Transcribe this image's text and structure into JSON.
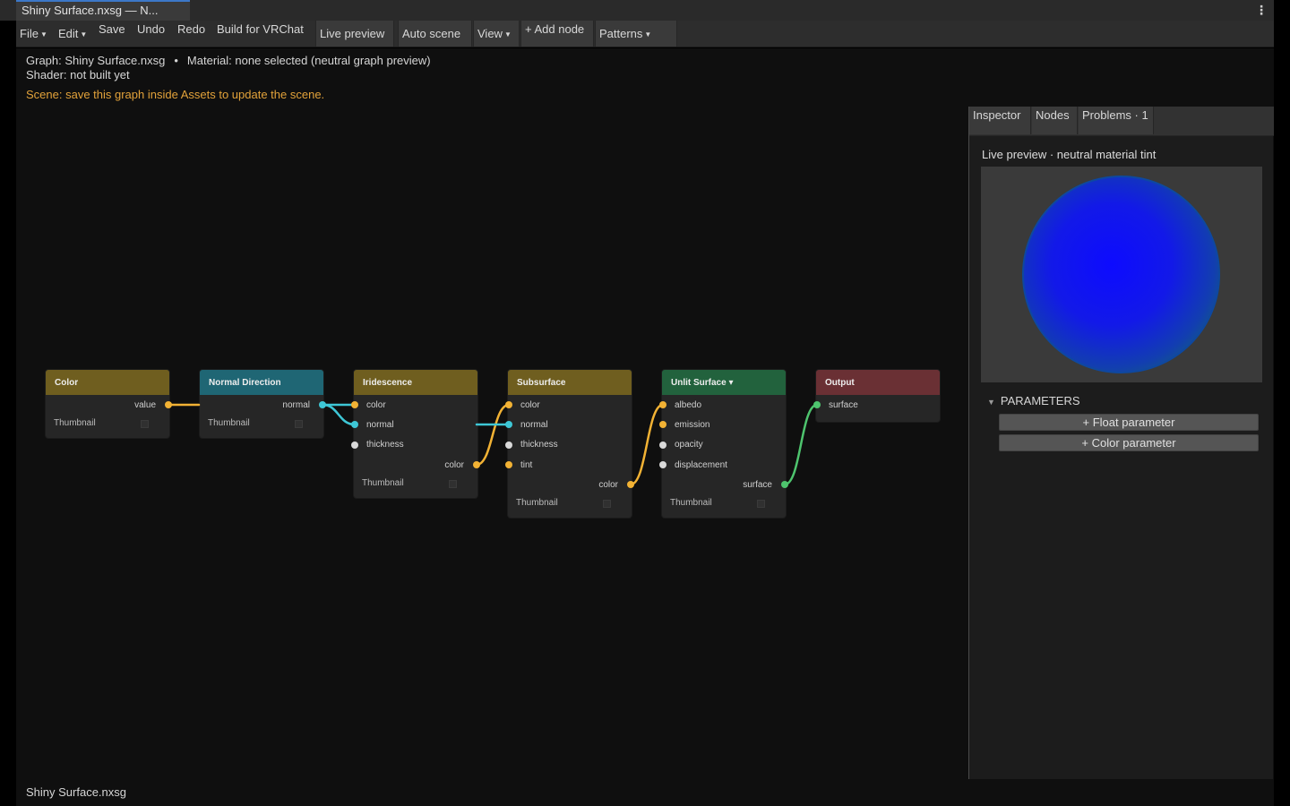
{
  "tab": {
    "title": "Shiny Surface.nxsg — N..."
  },
  "toolbar": {
    "file": "File",
    "edit": "Edit",
    "save": "Save",
    "undo": "Undo",
    "redo": "Redo",
    "build": "Build for VRChat",
    "live_preview": "Live preview",
    "auto_scene": "Auto scene",
    "view": "View",
    "add_node": "+ Add node",
    "patterns": "Patterns"
  },
  "info": {
    "graph": "Graph: Shiny Surface.nxsg",
    "material": "Material: none selected (neutral graph preview)",
    "shader": "Shader: not built yet",
    "scene": "Scene: save this graph inside Assets to update the scene."
  },
  "colors": {
    "yellow_header": "#6f5e1f",
    "teal_header": "#1f6674",
    "green_header": "#22623d",
    "red_header": "#6a3034",
    "port_yellow": "#f2b234",
    "port_cyan": "#3ec7d6",
    "port_white": "#d9d9d9",
    "port_green": "#4ec46e",
    "warning": "#e2a23a"
  },
  "nodes": [
    {
      "title": "Color",
      "outputs": [
        "value"
      ],
      "thumb": "Thumbnail"
    },
    {
      "title": "Normal Direction",
      "outputs": [
        "normal"
      ],
      "thumb": "Thumbnail"
    },
    {
      "title": "Iridescence",
      "inputs": [
        "color",
        "normal",
        "thickness"
      ],
      "outputs": [
        "color"
      ],
      "thumb": "Thumbnail"
    },
    {
      "title": "Subsurface",
      "inputs": [
        "color",
        "normal",
        "thickness",
        "tint"
      ],
      "outputs": [
        "color"
      ],
      "thumb": "Thumbnail"
    },
    {
      "title": "Unlit Surface ▾",
      "inputs": [
        "albedo",
        "emission",
        "opacity",
        "displacement"
      ],
      "outputs": [
        "surface"
      ],
      "thumb": "Thumbnail"
    },
    {
      "title": "Output",
      "inputs": [
        "surface"
      ]
    }
  ],
  "panel": {
    "tabs": [
      "Inspector",
      "Nodes",
      "Problems · 1"
    ],
    "preview_label": "Live preview · neutral material tint",
    "params_header": "PARAMETERS",
    "float_param": "+ Float parameter",
    "color_param": "+ Color parameter"
  },
  "status": {
    "file": "Shiny Surface.nxsg"
  }
}
